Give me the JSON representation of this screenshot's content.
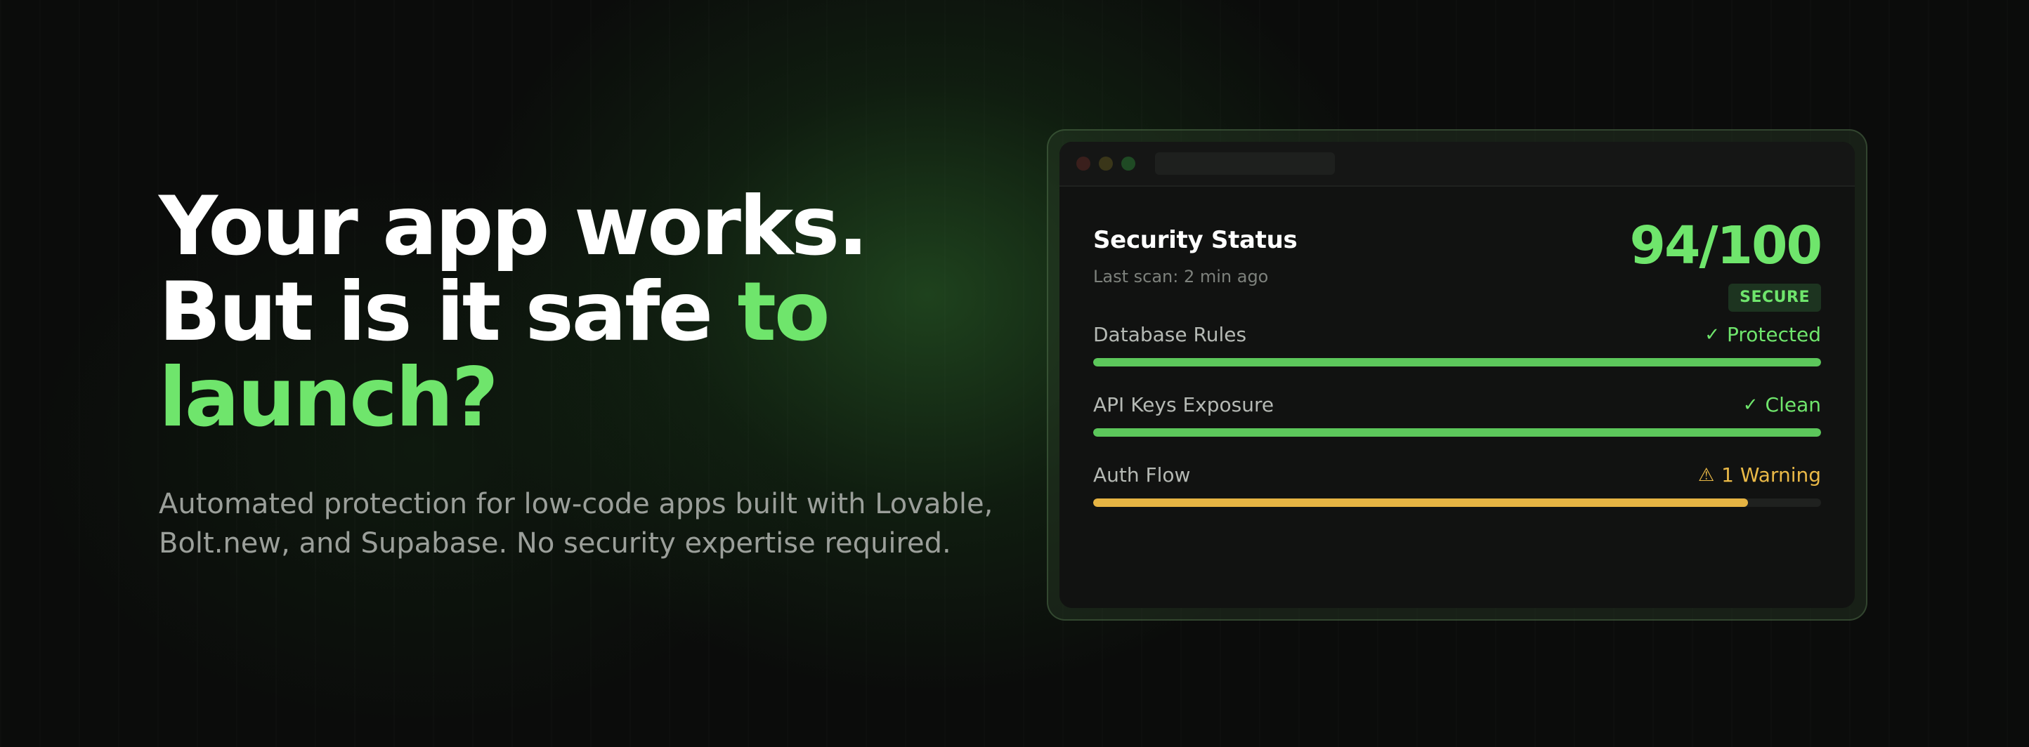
{
  "hero": {
    "headline_line1": "Your app works.",
    "headline_line2_plain": "But is it safe ",
    "headline_line2_accent": "to",
    "headline_line3_accent": "launch?",
    "subtitle_line1": "Automated protection for low-code apps built with Lovable,",
    "subtitle_line2": "Bolt.new, and Supabase. No security expertise required."
  },
  "window": {
    "controls": [
      "close-dot",
      "minimize-dot",
      "maximize-dot"
    ]
  },
  "security": {
    "title": "Security Status",
    "last_scan": "Last scan: 2 min ago",
    "score": "94/100",
    "badge": "SECURE",
    "checks": [
      {
        "label": "Database Rules",
        "status": "Protected",
        "icon": "check-icon",
        "glyph": "✓",
        "color": "#6fe56c",
        "bar_color": "#5cc75b",
        "progress": 1.0
      },
      {
        "label": "API Keys Exposure",
        "status": "Clean",
        "icon": "check-icon",
        "glyph": "✓",
        "color": "#6fe56c",
        "bar_color": "#5cc75b",
        "progress": 1.0
      },
      {
        "label": "Auth Flow",
        "status": "1 Warning",
        "icon": "warning-icon",
        "glyph": "⚠",
        "color": "#eab947",
        "bar_color": "#e6b443",
        "progress": 0.9
      }
    ]
  },
  "colors": {
    "accent": "#6fe56c",
    "warning": "#eab947",
    "background": "#0b0c0b"
  }
}
